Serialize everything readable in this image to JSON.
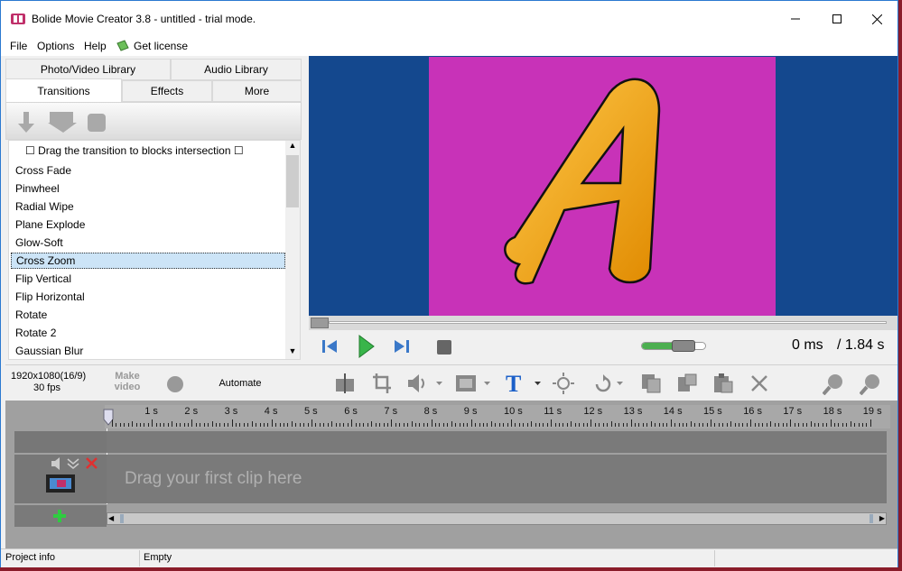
{
  "window": {
    "title": "Bolide Movie Creator 3.8 - untitled  - trial mode."
  },
  "menu": {
    "file": "File",
    "options": "Options",
    "help": "Help",
    "license": "Get license"
  },
  "tabs": {
    "photo_video": "Photo/Video Library",
    "audio": "Audio Library",
    "transitions": "Transitions",
    "effects": "Effects",
    "more": "More"
  },
  "transitions": {
    "hint": "☐ Drag the transition to blocks intersection ☐",
    "items": [
      "Cross Fade",
      "Pinwheel",
      "Radial Wipe",
      "Plane Explode",
      "Glow-Soft",
      "Cross Zoom",
      "Flip Vertical",
      "Flip Horizontal",
      "Rotate",
      "Rotate 2",
      "Gaussian Blur"
    ],
    "selected_index": 5
  },
  "player": {
    "current_time": "0 ms",
    "total_time": "/ 1.84 s",
    "preview_letter": "A",
    "volume": 0.75
  },
  "colors": {
    "preview_bg": "#14488e",
    "canvas": "#c832b8",
    "letter": "#f5a623",
    "accent": "#2b79d0"
  },
  "toolbar": {
    "resolution": "1920x1080(16/9)",
    "fps": "30 fps",
    "make_video": "Make video",
    "automate": "Automate"
  },
  "timeline": {
    "ruler": [
      "1 s",
      "2 s",
      "3 s",
      "4 s",
      "5 s",
      "6 s",
      "7 s",
      "8 s",
      "9 s",
      "10 s",
      "11 s",
      "12 s",
      "13 s",
      "14 s",
      "15 s",
      "16 s",
      "17 s",
      "18 s",
      "19 s"
    ],
    "drag_hint": "Drag your first clip here"
  },
  "status": {
    "project_info": "Project info",
    "state": "Empty"
  }
}
